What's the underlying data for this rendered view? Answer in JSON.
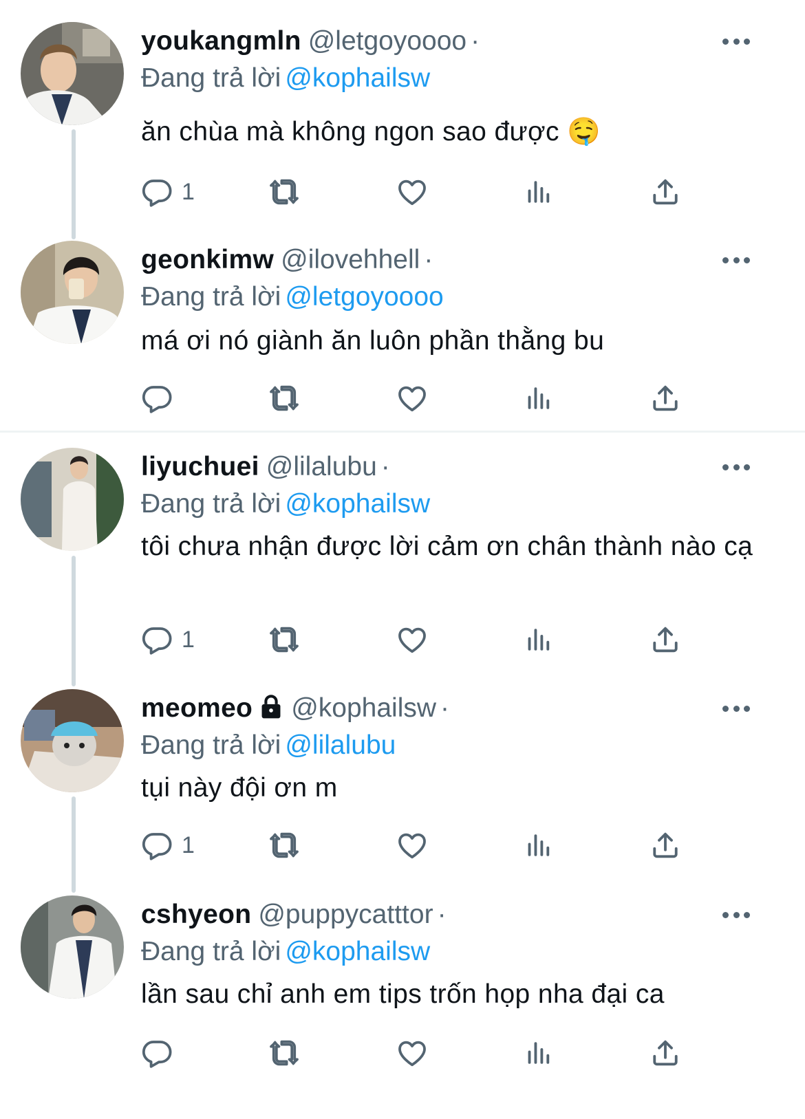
{
  "labels": {
    "replying_to": "Đang trả lời"
  },
  "colors": {
    "accent": "#1d9bf0",
    "muted": "#536471",
    "thread_line": "#cfd9de"
  },
  "tweets": [
    {
      "name": "youkangmln",
      "handle": "@letgoyoooo",
      "reply_to": "@kophailsw",
      "text": "ăn chùa mà không ngon sao được 🤤",
      "reply_count": "1",
      "locked": false
    },
    {
      "name": "geonkimw",
      "handle": "@ilovehhell",
      "reply_to": "@letgoyoooo",
      "text": "má ơi nó giành ăn luôn phần thằng bu",
      "reply_count": "",
      "locked": false
    },
    {
      "name": "liyuchuei",
      "handle": "@lilalubu",
      "reply_to": "@kophailsw",
      "text": "tôi chưa nhận được lời cảm ơn chân thành nào cạ",
      "reply_count": "1",
      "locked": false
    },
    {
      "name": "meomeo",
      "handle": "@kophailsw",
      "reply_to": "@lilalubu",
      "text": "tụi này đội ơn m",
      "reply_count": "1",
      "locked": true
    },
    {
      "name": "cshyeon",
      "handle": "@puppycatttor",
      "reply_to": "@kophailsw",
      "text": "lần sau chỉ anh em tips trốn họp nha đại ca",
      "reply_count": "",
      "locked": false
    }
  ],
  "icons": [
    "reply-icon",
    "retweet-icon",
    "like-icon",
    "views-icon",
    "share-icon",
    "more-icon",
    "lock-icon"
  ]
}
